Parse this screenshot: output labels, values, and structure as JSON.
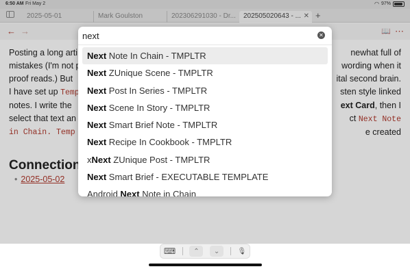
{
  "status": {
    "time": "6:50 AM",
    "date": "Fri May 2",
    "battery": "97%"
  },
  "tabs": [
    {
      "label": "2025-05-01"
    },
    {
      "label": "Mark Goulston"
    },
    {
      "label": "202306291030 - Dr..."
    },
    {
      "label": "202505020643 - ...",
      "active": true,
      "close": "✕"
    }
  ],
  "newtab": "+",
  "nav": {
    "back": "←",
    "forward": "→",
    "reading": "📖",
    "more": "⋯"
  },
  "editor": {
    "p1_a": "Posting a long arti",
    "p1_b": "newhat full of",
    "p2_a": "mistakes (I'm not p",
    "p2_b": "wording when it",
    "p3_a": "proof reads.)  But",
    "p3_b": "ital second brain.",
    "p4_a": "I have set up ",
    "p4_code": "Temp",
    "p4_b": "sten style linked",
    "p5_a": "notes.  I write the",
    "p5_bold": "ext Card",
    "p5_b": ", then I",
    "p6_a": "select that text an",
    "p6_b": "ct ",
    "p6_code": "Next Note",
    "p7_code1": " in Chain.  Temp",
    "p7_b": "e created",
    "heading": "Connection",
    "backlink": "2025-05-02"
  },
  "palette": {
    "query": "next",
    "clear_icon": "✕",
    "results": [
      {
        "pre": "",
        "match": "Next",
        "post": " Note In Chain - TMPLTR"
      },
      {
        "pre": "",
        "match": "Next",
        "post": " ZUnique Scene - TMPLTR"
      },
      {
        "pre": "",
        "match": "Next",
        "post": " Post In Series - TMPLTR"
      },
      {
        "pre": "",
        "match": "Next",
        "post": " Scene In Story - TMPLTR"
      },
      {
        "pre": "",
        "match": "Next",
        "post": " Smart Brief Note - TMPLTR"
      },
      {
        "pre": "",
        "match": "Next",
        "post": " Recipe In Cookbook - TMPLTR"
      },
      {
        "pre": "x",
        "match": "Next",
        "post": " ZUnique Post - TMPLTR"
      },
      {
        "pre": "",
        "match": "Next",
        "post": " Smart Brief - EXECUTABLE TEMPLATE"
      },
      {
        "pre": "Android ",
        "match": "Next",
        "post": " Note in Chain"
      }
    ]
  },
  "keyboard_bar": {
    "kbd": "⌨",
    "up": "⌃",
    "down": "⌄",
    "mic": "🎙"
  }
}
